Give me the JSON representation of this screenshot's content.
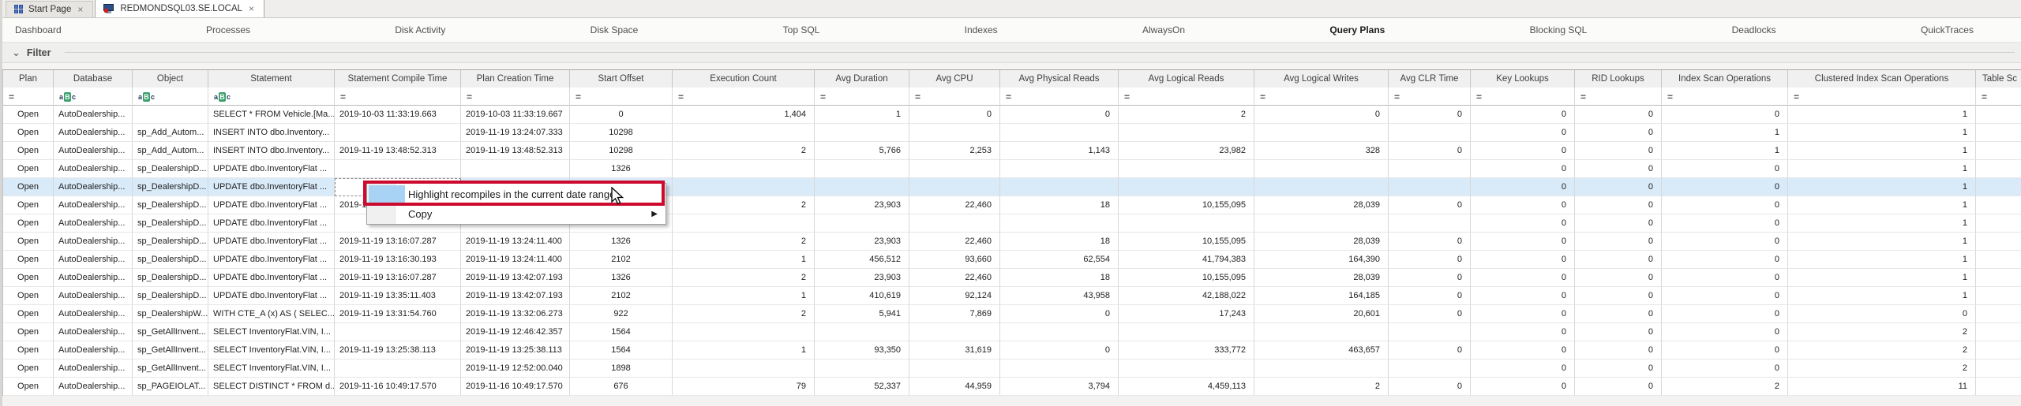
{
  "window_tabs": {
    "close_glyph": "×",
    "items": [
      {
        "label": "Start Page",
        "icon": "start-page-icon",
        "active": false
      },
      {
        "label": "REDMONDSQL03.SE.LOCAL",
        "icon": "server-icon",
        "active": true
      }
    ]
  },
  "nav": {
    "active": "Query Plans",
    "items": [
      "Dashboard",
      "Processes",
      "Disk Activity",
      "Disk Space",
      "Top SQL",
      "Indexes",
      "AlwaysOn",
      "Query Plans",
      "Blocking SQL",
      "Deadlocks",
      "QuickTraces"
    ]
  },
  "filter": {
    "label": "Filter",
    "collapse_glyph": "⌄"
  },
  "grid": {
    "columns": [
      {
        "label": "Plan",
        "filter": "eq",
        "align": "center"
      },
      {
        "label": "Database",
        "filter": "abc",
        "align": "left"
      },
      {
        "label": "Object",
        "filter": "abc",
        "align": "left"
      },
      {
        "label": "Statement",
        "filter": "abc",
        "align": "left"
      },
      {
        "label": "Statement Compile Time",
        "filter": "eq",
        "align": "left"
      },
      {
        "label": "Plan Creation Time",
        "filter": "eq",
        "align": "left"
      },
      {
        "label": "Start Offset",
        "filter": "eq",
        "align": "center"
      },
      {
        "label": "Execution Count",
        "filter": "eq",
        "align": "right"
      },
      {
        "label": "Avg Duration",
        "filter": "eq",
        "align": "right"
      },
      {
        "label": "Avg CPU",
        "filter": "eq",
        "align": "right"
      },
      {
        "label": "Avg Physical Reads",
        "filter": "eq",
        "align": "right"
      },
      {
        "label": "Avg Logical Reads",
        "filter": "eq",
        "align": "right"
      },
      {
        "label": "Avg Logical Writes",
        "filter": "eq",
        "align": "right"
      },
      {
        "label": "Avg CLR Time",
        "filter": "eq",
        "align": "right"
      },
      {
        "label": "Key Lookups",
        "filter": "eq",
        "align": "right"
      },
      {
        "label": "RID Lookups",
        "filter": "eq",
        "align": "right"
      },
      {
        "label": "Index Scan Operations",
        "filter": "eq",
        "align": "right"
      },
      {
        "label": "Clustered Index Scan Operations",
        "filter": "eq",
        "align": "right"
      },
      {
        "label": "Table Sc",
        "filter": "eq",
        "align": "left"
      }
    ],
    "selected_row_index": 4,
    "focused_cell": {
      "row": 4,
      "col": 4
    },
    "rows": [
      [
        "Open",
        "AutoDealership...",
        "",
        "SELECT * FROM Vehicle.[Ma...",
        "2019-10-03 11:33:19.663",
        "2019-10-03 11:33:19.667",
        "0",
        "1,404",
        "1",
        "0",
        "0",
        "2",
        "0",
        "0",
        "0",
        "0",
        "0",
        "1",
        ""
      ],
      [
        "Open",
        "AutoDealership...",
        "sp_Add_Autom...",
        "INSERT INTO dbo.Inventory...",
        "",
        "2019-11-19 13:24:07.333",
        "10298",
        "",
        "",
        "",
        "",
        "",
        "",
        "",
        "0",
        "0",
        "1",
        "1",
        ""
      ],
      [
        "Open",
        "AutoDealership...",
        "sp_Add_Autom...",
        "INSERT INTO dbo.Inventory...",
        "2019-11-19 13:48:52.313",
        "2019-11-19 13:48:52.313",
        "10298",
        "2",
        "5,766",
        "2,253",
        "1,143",
        "23,982",
        "328",
        "0",
        "0",
        "0",
        "1",
        "1",
        ""
      ],
      [
        "Open",
        "AutoDealership...",
        "sp_DealershipD...",
        "UPDATE dbo.InventoryFlat ...",
        "",
        "",
        "1326",
        "",
        "",
        "",
        "",
        "",
        "",
        "",
        "0",
        "0",
        "0",
        "1",
        ""
      ],
      [
        "Open",
        "AutoDealership...",
        "sp_DealershipD...",
        "UPDATE dbo.InventoryFlat ...",
        "",
        "",
        "",
        "",
        "",
        "",
        "",
        "",
        "",
        "",
        "0",
        "0",
        "0",
        "1",
        ""
      ],
      [
        "Open",
        "AutoDealership...",
        "sp_DealershipD...",
        "UPDATE dbo.InventoryFlat ...",
        "2019-1",
        "",
        "",
        "2",
        "23,903",
        "22,460",
        "18",
        "10,155,095",
        "28,039",
        "0",
        "0",
        "0",
        "0",
        "1",
        ""
      ],
      [
        "Open",
        "AutoDealership...",
        "sp_DealershipD...",
        "UPDATE dbo.InventoryFlat ...",
        "",
        "",
        "",
        "",
        "",
        "",
        "",
        "",
        "",
        "",
        "0",
        "0",
        "0",
        "1",
        ""
      ],
      [
        "Open",
        "AutoDealership...",
        "sp_DealershipD...",
        "UPDATE dbo.InventoryFlat ...",
        "2019-11-19 13:16:07.287",
        "2019-11-19 13:24:11.400",
        "1326",
        "2",
        "23,903",
        "22,460",
        "18",
        "10,155,095",
        "28,039",
        "0",
        "0",
        "0",
        "0",
        "1",
        ""
      ],
      [
        "Open",
        "AutoDealership...",
        "sp_DealershipD...",
        "UPDATE dbo.InventoryFlat ...",
        "2019-11-19 13:16:30.193",
        "2019-11-19 13:24:11.400",
        "2102",
        "1",
        "456,512",
        "93,660",
        "62,554",
        "41,794,383",
        "164,390",
        "0",
        "0",
        "0",
        "0",
        "1",
        ""
      ],
      [
        "Open",
        "AutoDealership...",
        "sp_DealershipD...",
        "UPDATE dbo.InventoryFlat ...",
        "2019-11-19 13:16:07.287",
        "2019-11-19 13:42:07.193",
        "1326",
        "2",
        "23,903",
        "22,460",
        "18",
        "10,155,095",
        "28,039",
        "0",
        "0",
        "0",
        "0",
        "1",
        ""
      ],
      [
        "Open",
        "AutoDealership...",
        "sp_DealershipD...",
        "UPDATE dbo.InventoryFlat ...",
        "2019-11-19 13:35:11.403",
        "2019-11-19 13:42:07.193",
        "2102",
        "1",
        "410,619",
        "92,124",
        "43,958",
        "42,188,022",
        "164,185",
        "0",
        "0",
        "0",
        "0",
        "1",
        ""
      ],
      [
        "Open",
        "AutoDealership...",
        "sp_DealershipW...",
        "WITH CTE_A (x) AS ( SELEC...",
        "2019-11-19 13:31:54.760",
        "2019-11-19 13:32:06.273",
        "922",
        "2",
        "5,941",
        "7,869",
        "0",
        "17,243",
        "20,601",
        "0",
        "0",
        "0",
        "0",
        "0",
        ""
      ],
      [
        "Open",
        "AutoDealership...",
        "sp_GetAllInvent...",
        "SELECT InventoryFlat.VIN, I...",
        "",
        "2019-11-19 12:46:42.357",
        "1564",
        "",
        "",
        "",
        "",
        "",
        "",
        "",
        "0",
        "0",
        "0",
        "2",
        ""
      ],
      [
        "Open",
        "AutoDealership...",
        "sp_GetAllInvent...",
        "SELECT InventoryFlat.VIN, I...",
        "2019-11-19 13:25:38.113",
        "2019-11-19 13:25:38.113",
        "1564",
        "1",
        "93,350",
        "31,619",
        "0",
        "333,772",
        "463,657",
        "0",
        "0",
        "0",
        "0",
        "2",
        ""
      ],
      [
        "Open",
        "AutoDealership...",
        "sp_GetAllInvent...",
        "SELECT InventoryFlat.VIN, I...",
        "",
        "2019-11-19 12:52:00.040",
        "1898",
        "",
        "",
        "",
        "",
        "",
        "",
        "",
        "0",
        "0",
        "0",
        "2",
        ""
      ],
      [
        "Open",
        "AutoDealership...",
        "sp_PAGEIOLAT...",
        "SELECT DISTINCT * FROM d...",
        "2019-11-16 10:49:17.570",
        "2019-11-16 10:49:17.570",
        "676",
        "79",
        "52,337",
        "44,959",
        "3,794",
        "4,459,113",
        "2",
        "0",
        "0",
        "0",
        "2",
        "11",
        ""
      ]
    ]
  },
  "context_menu": {
    "items": [
      {
        "label": "Highlight recompiles in the current date range",
        "highlighted": true,
        "submenu": false
      },
      {
        "label": "Copy",
        "highlighted": false,
        "submenu": true
      }
    ],
    "submenu_glyph": "▶"
  },
  "colors": {
    "selection_blue": "#d9eaf8",
    "annotation_red": "#cb0a2e",
    "abc_icon_green": "#3aa06c",
    "menu_gutter_highlight": "#a9d3f4"
  }
}
